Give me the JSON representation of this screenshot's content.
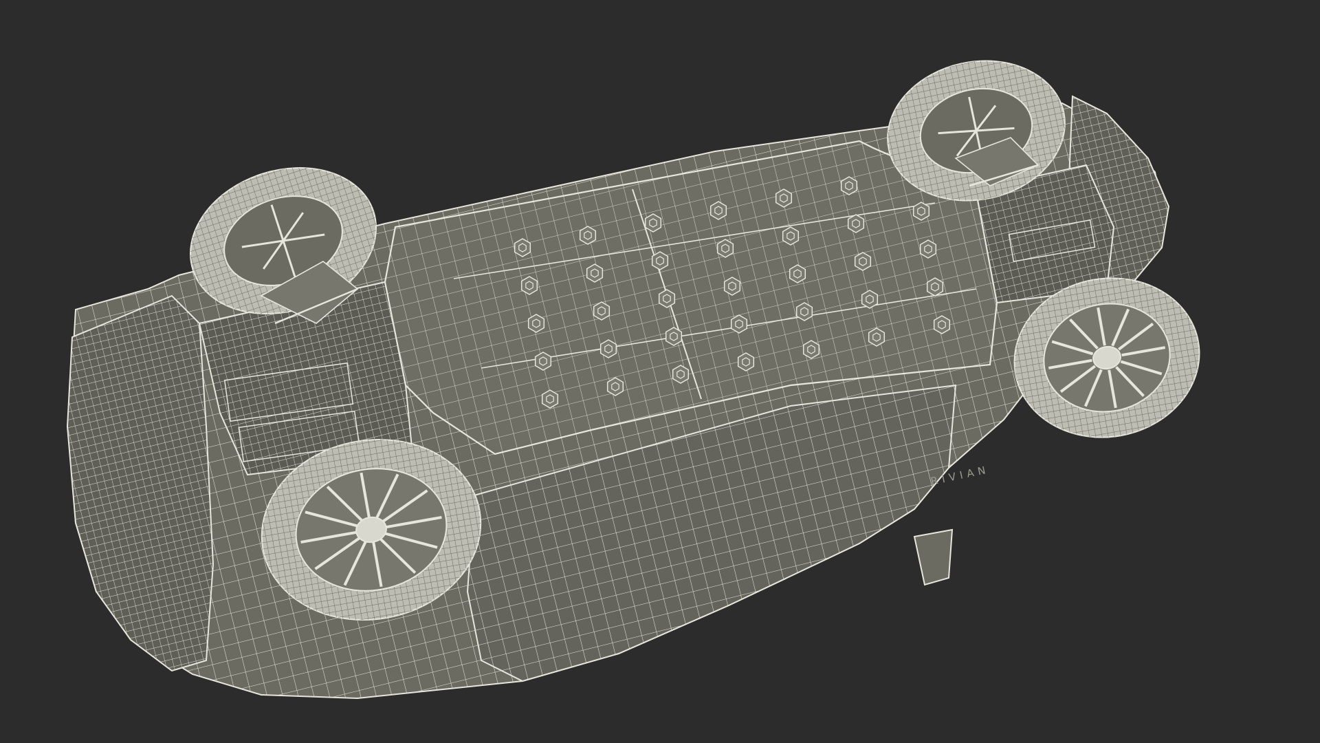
{
  "scene": {
    "background_color": "#2c2c2c",
    "body_color": "#6b6b62",
    "body_shade_color": "#56564f",
    "wire_color": "#e6e6dc",
    "tire_color": "#bdbdb3",
    "render_style": "wireframe-over-shaded",
    "view": "underside"
  },
  "labels": {
    "brand": "RIVIAN"
  },
  "icons": {
    "battery_fasteners": "hexagon-bolt-icon",
    "wheel": "wheel-icon"
  }
}
